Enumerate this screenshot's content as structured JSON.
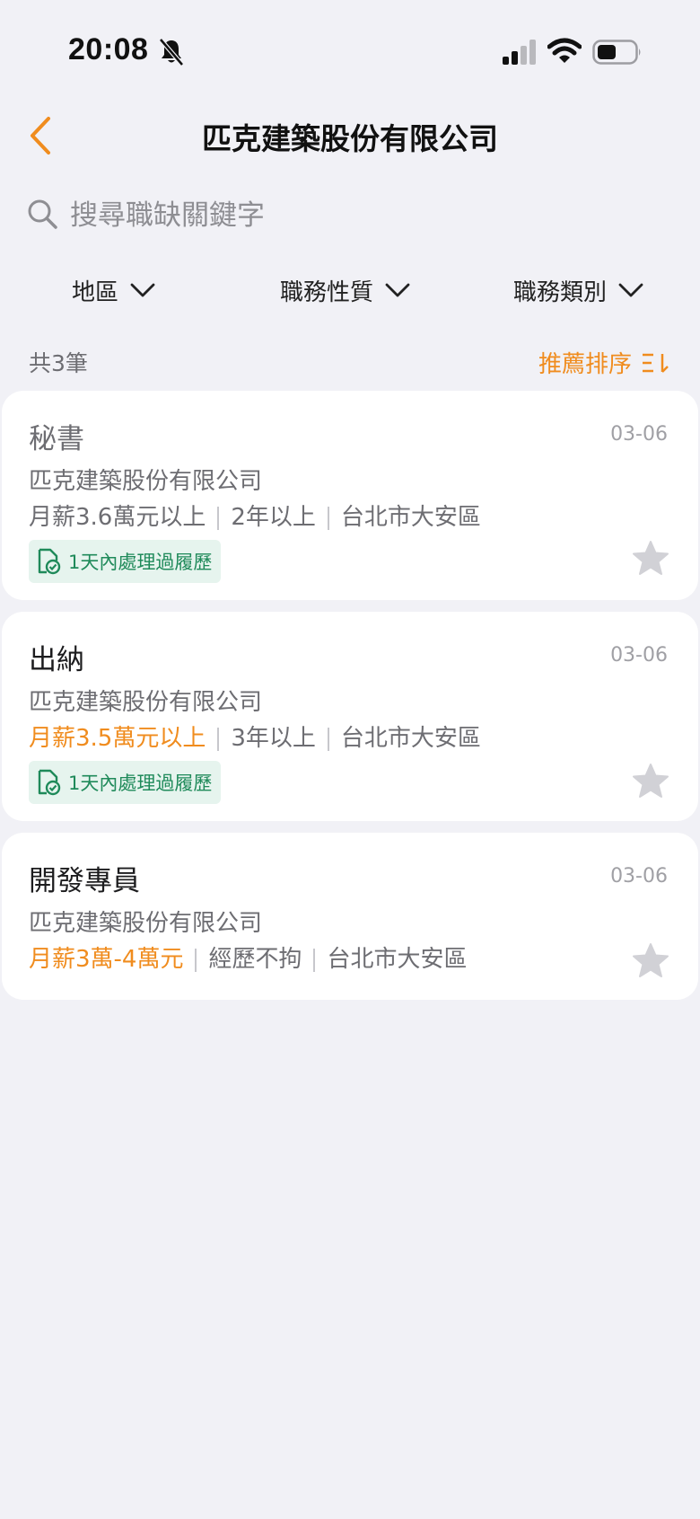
{
  "status_bar": {
    "time": "20:08"
  },
  "nav": {
    "title": "匹克建築股份有限公司"
  },
  "search": {
    "placeholder": "搜尋職缺關鍵字"
  },
  "filters": [
    {
      "label": "地區"
    },
    {
      "label": "職務性質"
    },
    {
      "label": "職務類別"
    }
  ],
  "list": {
    "count": "共3筆",
    "sort_label": "推薦排序"
  },
  "jobs": [
    {
      "title": "秘書",
      "date": "03-06",
      "company": "匹克建築股份有限公司",
      "salary": "月薪3.6萬元以上",
      "experience": "2年以上",
      "location": "台北市大安區",
      "badge": "1天內處理過履歷",
      "viewed": true
    },
    {
      "title": "出納",
      "date": "03-06",
      "company": "匹克建築股份有限公司",
      "salary": "月薪3.5萬元以上",
      "experience": "3年以上",
      "location": "台北市大安區",
      "badge": "1天內處理過履歷",
      "viewed": false
    },
    {
      "title": "開發專員",
      "date": "03-06",
      "company": "匹克建築股份有限公司",
      "salary": "月薪3萬-4萬元",
      "experience": "經歷不拘",
      "location": "台北市大安區",
      "viewed": false
    }
  ],
  "colors": {
    "accent": "#f08c1e",
    "badge_text": "#1f8a5a",
    "badge_bg": "#e6f4ee",
    "background": "#f1f1f6"
  },
  "icons": [
    "chevron-left-icon",
    "search-icon",
    "chevron-down-icon",
    "sort-icon",
    "document-check-icon",
    "star-icon",
    "bell-off-icon",
    "signal-icon",
    "wifi-icon",
    "battery-icon"
  ]
}
